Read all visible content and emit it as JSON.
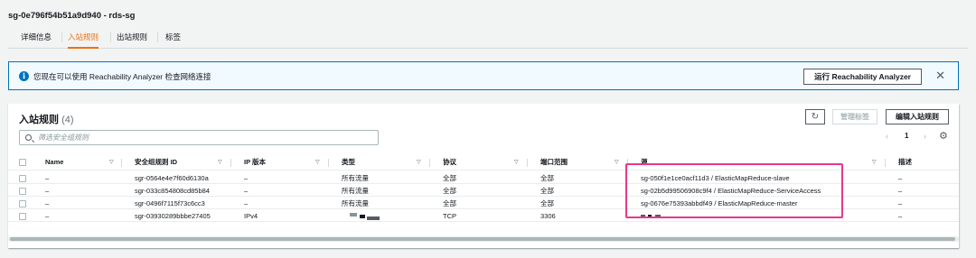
{
  "page": {
    "title": "sg-0e796f54b51a9d940 - rds-sg"
  },
  "tabs": [
    {
      "label": "详细信息",
      "active": false
    },
    {
      "label": "入站规则",
      "active": true
    },
    {
      "label": "出站规则",
      "active": false
    },
    {
      "label": "标签",
      "active": false
    }
  ],
  "banner": {
    "icon": "info-icon",
    "text": "您现在可以使用 Reachability Analyzer 检查网络连接",
    "run_button": "运行 Reachability Analyzer",
    "close_icon": "close-icon"
  },
  "inbound": {
    "title": "入站规则",
    "count": "(4)",
    "refresh_icon": "refresh-icon",
    "manage_tags_button": "管理标签",
    "edit_button": "编辑入站规则",
    "search_placeholder": "筛选安全组规则",
    "pager": {
      "prev": "‹",
      "page": "1",
      "next": "›"
    },
    "settings_icon": "gear-icon"
  },
  "table": {
    "columns": [
      "Name",
      "安全组规则 ID",
      "IP 版本",
      "类型",
      "协议",
      "端口范围",
      "源",
      "描述"
    ],
    "rows": [
      {
        "name": "–",
        "rule_id": "sgr-0564e4e7f60d6130a",
        "ip_version": "–",
        "type": "所有流量",
        "protocol": "全部",
        "port_range": "全部",
        "source": "sg-050f1e1ce0acf11d3 / ElasticMapReduce-slave",
        "description": "–"
      },
      {
        "name": "–",
        "rule_id": "sgr-033c854808cd85b84",
        "ip_version": "–",
        "type": "所有流量",
        "protocol": "全部",
        "port_range": "全部",
        "source": "sg-02b5d99506908c9f4 / ElasticMapReduce-ServiceAccess",
        "description": "–"
      },
      {
        "name": "–",
        "rule_id": "sgr-0496f7115f73c6cc3",
        "ip_version": "–",
        "type": "所有流量",
        "protocol": "全部",
        "port_range": "全部",
        "source": "sg-0676e75393abbdf49 / ElasticMapReduce-master",
        "description": "–"
      },
      {
        "name": "–",
        "rule_id": "sgr-03930289bbbe27405",
        "ip_version": "IPv4",
        "type": "",
        "protocol": "TCP",
        "port_range": "3306",
        "source": "",
        "description": "–"
      }
    ]
  },
  "colors": {
    "accent": "#ec7211",
    "info_border": "#0073bb",
    "highlight": "#e8378c"
  }
}
